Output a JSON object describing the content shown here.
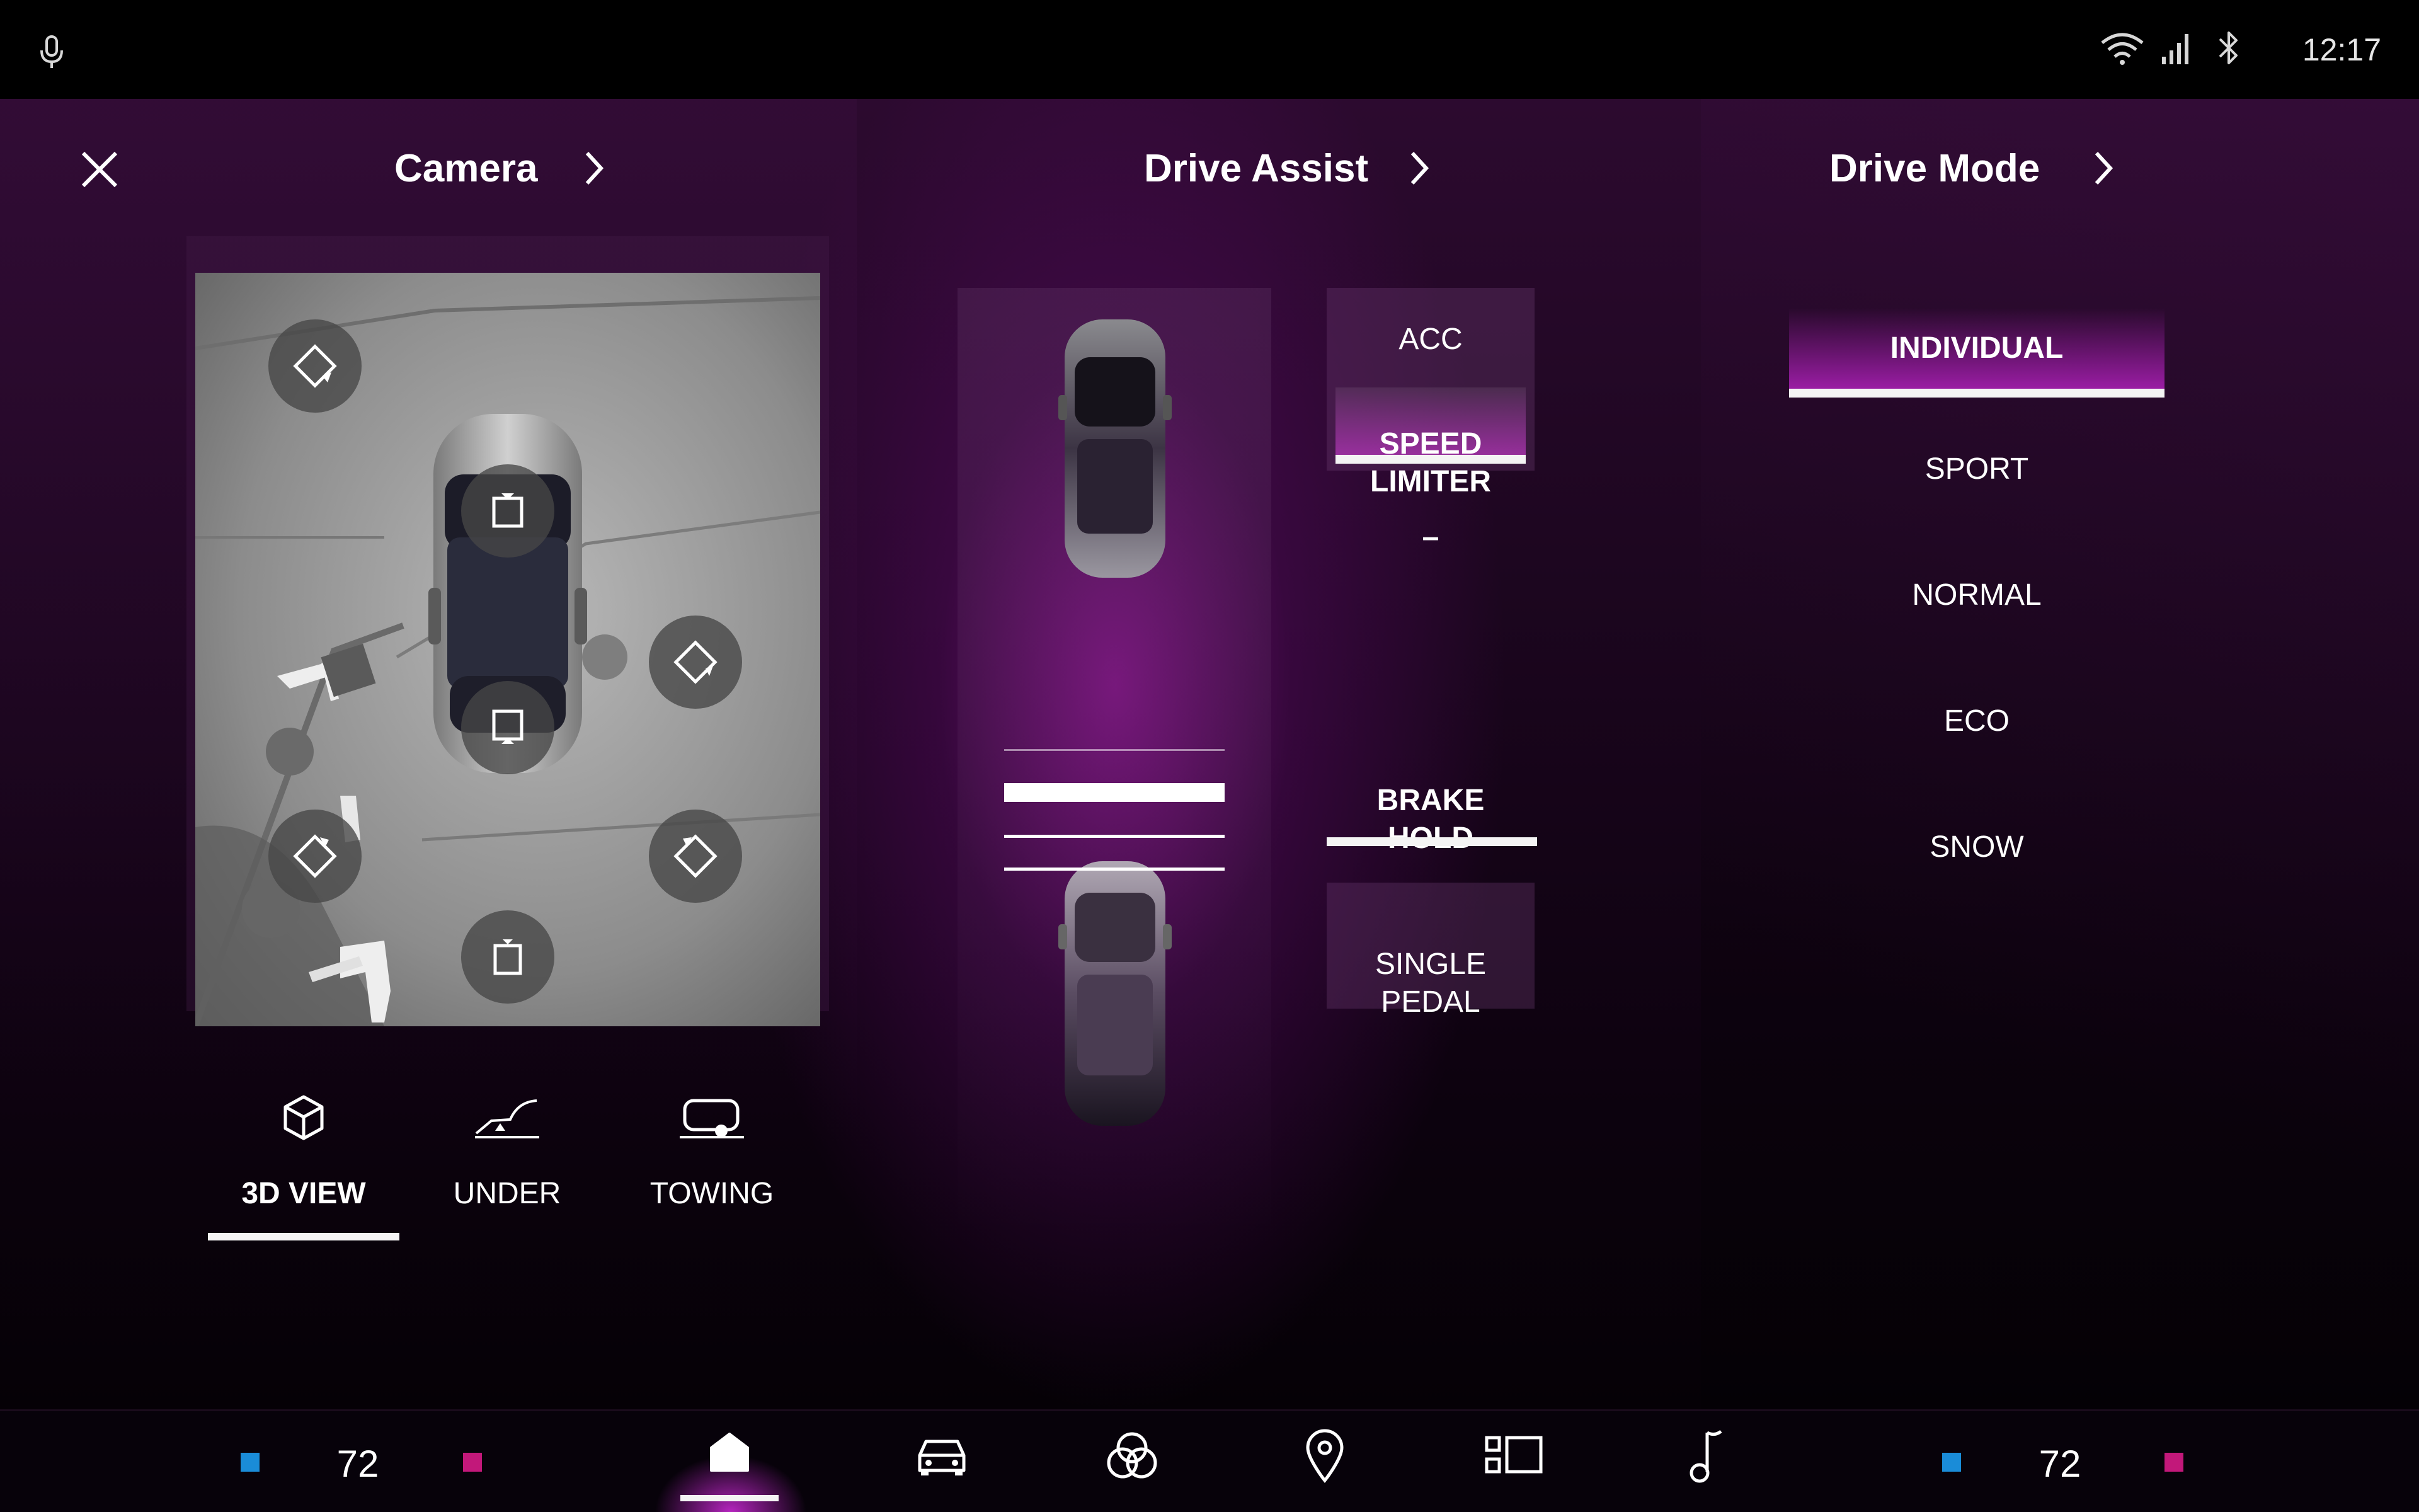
{
  "status_bar": {
    "time": "12:17",
    "icons": [
      "microphone-icon",
      "wifi-icon",
      "cellular-signal-icon",
      "bluetooth-icon"
    ]
  },
  "camera": {
    "title": "Camera",
    "view_buttons": [
      "camera-front-left-icon",
      "camera-top-front-icon",
      "camera-right-icon",
      "camera-top-rear-icon",
      "camera-rear-left-icon",
      "camera-rear-right-icon",
      "camera-rear-icon"
    ],
    "modes": [
      {
        "label": "3D VIEW",
        "icon": "cube-icon",
        "active": true
      },
      {
        "label": "UNDER",
        "icon": "under-view-icon",
        "active": false
      },
      {
        "label": "TOWING",
        "icon": "trailer-icon",
        "active": false
      }
    ]
  },
  "drive_assist": {
    "title": "Drive Assist",
    "distance_levels_total": 4,
    "distance_level_selected": 2,
    "items": [
      {
        "label": "ACC",
        "state": "available"
      },
      {
        "label": "SPEED\nLIMITER",
        "state": "active"
      },
      {
        "label": "–",
        "state": "divider"
      },
      {
        "label": "BRAKE\nHOLD",
        "state": "active"
      },
      {
        "label": "SINGLE\nPEDAL",
        "state": "available"
      }
    ]
  },
  "drive_mode": {
    "title": "Drive Mode",
    "modes": [
      "INDIVIDUAL",
      "SPORT",
      "NORMAL",
      "ECO",
      "SNOW"
    ],
    "selected": "INDIVIDUAL"
  },
  "nav_bar": {
    "left_temp": "72",
    "right_temp": "72",
    "items": [
      "home-icon",
      "car-icon",
      "media-sources-icon",
      "navigation-pin-icon",
      "apps-icon",
      "music-note-icon"
    ],
    "active": "home-icon",
    "colors": {
      "cool": "#1a8cd8",
      "warm": "#c2187a"
    }
  },
  "colors": {
    "accent": "#b12ab8",
    "background": "#1d0620"
  }
}
